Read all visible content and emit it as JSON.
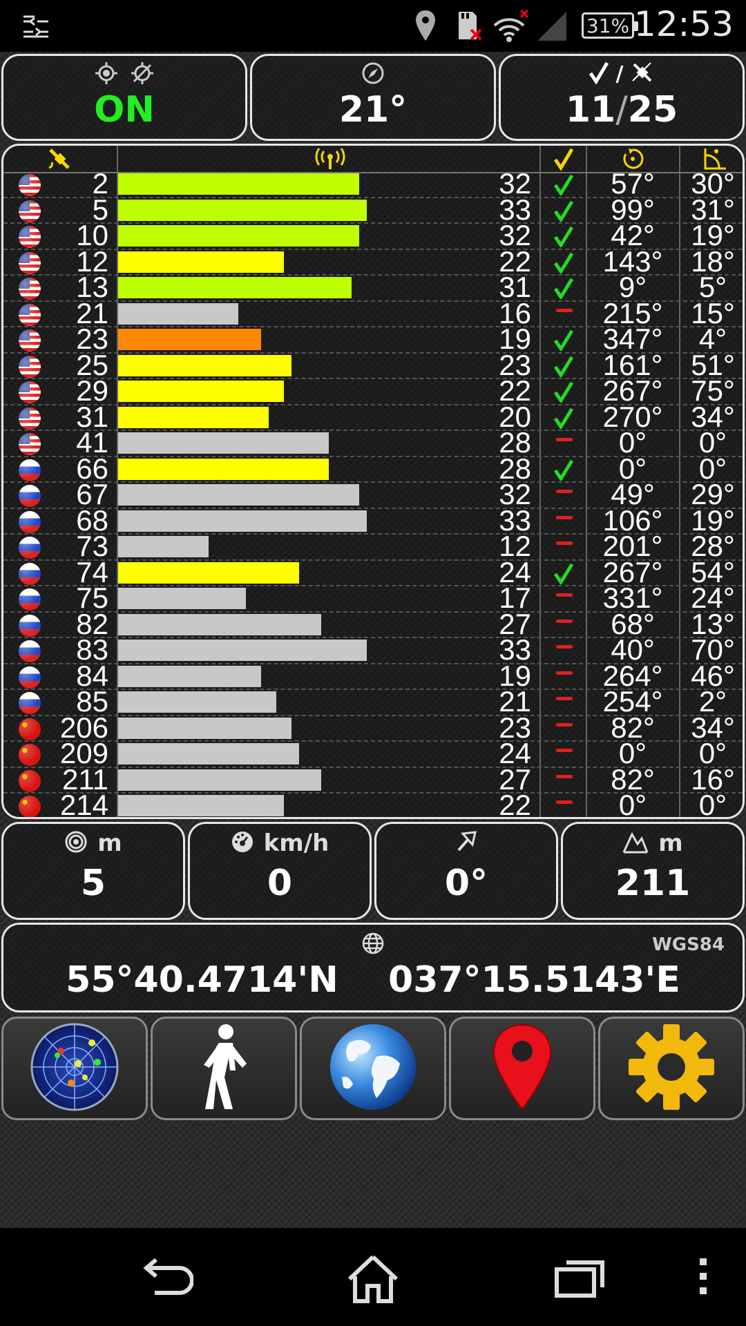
{
  "status_bar": {
    "time": "12:53",
    "battery": "31%",
    "icons": [
      "menu-sort-icon",
      "location-pin-icon",
      "sd-card-error-icon",
      "wifi-error-icon",
      "no-signal-icon",
      "battery-icon"
    ]
  },
  "tiles": {
    "gps_status": {
      "icons": [
        "gps-fix-icon",
        "gps-off-icon"
      ],
      "value": "ON",
      "color": "#22ee22"
    },
    "compass": {
      "icon": "compass-icon",
      "value": "21°"
    },
    "satellites": {
      "icons": [
        "check-icon",
        "satellite-icon"
      ],
      "separator": "/",
      "used": "11",
      "slash": "/",
      "total": "25"
    }
  },
  "table": {
    "header_icons": [
      "satellite-icon",
      "signal-icon",
      "check-icon",
      "azimuth-icon",
      "elevation-icon"
    ],
    "colors": {
      "good": "#bfff00",
      "mid": "#ffff00",
      "weak": "#ff8800",
      "unused": "#c8c8c8",
      "check": "#22dd22",
      "dash": "#e02020"
    },
    "rows": [
      {
        "flag": "us",
        "prn": "2",
        "snr": "32",
        "level": 32,
        "used": true,
        "az": "57°",
        "el": "30°",
        "color": "#bfff00"
      },
      {
        "flag": "us",
        "prn": "5",
        "snr": "33",
        "level": 33,
        "used": true,
        "az": "99°",
        "el": "31°",
        "color": "#bfff00"
      },
      {
        "flag": "us",
        "prn": "10",
        "snr": "32",
        "level": 32,
        "used": true,
        "az": "42°",
        "el": "19°",
        "color": "#bfff00"
      },
      {
        "flag": "us",
        "prn": "12",
        "snr": "22",
        "level": 22,
        "used": true,
        "az": "143°",
        "el": "18°",
        "color": "#ffff00"
      },
      {
        "flag": "us",
        "prn": "13",
        "snr": "31",
        "level": 31,
        "used": true,
        "az": "9°",
        "el": "5°",
        "color": "#bfff00"
      },
      {
        "flag": "us",
        "prn": "21",
        "snr": "16",
        "level": 16,
        "used": false,
        "az": "215°",
        "el": "15°",
        "color": "#c8c8c8"
      },
      {
        "flag": "us",
        "prn": "23",
        "snr": "19",
        "level": 19,
        "used": true,
        "az": "347°",
        "el": "4°",
        "color": "#ff8800"
      },
      {
        "flag": "us",
        "prn": "25",
        "snr": "23",
        "level": 23,
        "used": true,
        "az": "161°",
        "el": "51°",
        "color": "#ffff00"
      },
      {
        "flag": "us",
        "prn": "29",
        "snr": "22",
        "level": 22,
        "used": true,
        "az": "267°",
        "el": "75°",
        "color": "#ffff00"
      },
      {
        "flag": "us",
        "prn": "31",
        "snr": "20",
        "level": 20,
        "used": true,
        "az": "270°",
        "el": "34°",
        "color": "#ffff00"
      },
      {
        "flag": "us",
        "prn": "41",
        "snr": "28",
        "level": 28,
        "used": false,
        "az": "0°",
        "el": "0°",
        "color": "#c8c8c8"
      },
      {
        "flag": "ru",
        "prn": "66",
        "snr": "28",
        "level": 28,
        "used": true,
        "az": "0°",
        "el": "0°",
        "color": "#ffff00"
      },
      {
        "flag": "ru",
        "prn": "67",
        "snr": "32",
        "level": 32,
        "used": false,
        "az": "49°",
        "el": "29°",
        "color": "#c8c8c8"
      },
      {
        "flag": "ru",
        "prn": "68",
        "snr": "33",
        "level": 33,
        "used": false,
        "az": "106°",
        "el": "19°",
        "color": "#c8c8c8"
      },
      {
        "flag": "ru",
        "prn": "73",
        "snr": "12",
        "level": 12,
        "used": false,
        "az": "201°",
        "el": "28°",
        "color": "#c8c8c8"
      },
      {
        "flag": "ru",
        "prn": "74",
        "snr": "24",
        "level": 24,
        "used": true,
        "az": "267°",
        "el": "54°",
        "color": "#ffff00"
      },
      {
        "flag": "ru",
        "prn": "75",
        "snr": "17",
        "level": 17,
        "used": false,
        "az": "331°",
        "el": "24°",
        "color": "#c8c8c8"
      },
      {
        "flag": "ru",
        "prn": "82",
        "snr": "27",
        "level": 27,
        "used": false,
        "az": "68°",
        "el": "13°",
        "color": "#c8c8c8"
      },
      {
        "flag": "ru",
        "prn": "83",
        "snr": "33",
        "level": 33,
        "used": false,
        "az": "40°",
        "el": "70°",
        "color": "#c8c8c8"
      },
      {
        "flag": "ru",
        "prn": "84",
        "snr": "19",
        "level": 19,
        "used": false,
        "az": "264°",
        "el": "46°",
        "color": "#c8c8c8"
      },
      {
        "flag": "ru",
        "prn": "85",
        "snr": "21",
        "level": 21,
        "used": false,
        "az": "254°",
        "el": "2°",
        "color": "#c8c8c8"
      },
      {
        "flag": "cn",
        "prn": "206",
        "snr": "23",
        "level": 23,
        "used": false,
        "az": "82°",
        "el": "34°",
        "color": "#c8c8c8"
      },
      {
        "flag": "cn",
        "prn": "209",
        "snr": "24",
        "level": 24,
        "used": false,
        "az": "0°",
        "el": "0°",
        "color": "#c8c8c8"
      },
      {
        "flag": "cn",
        "prn": "211",
        "snr": "27",
        "level": 27,
        "used": false,
        "az": "82°",
        "el": "16°",
        "color": "#c8c8c8"
      },
      {
        "flag": "cn",
        "prn": "214",
        "snr": "22",
        "level": 22,
        "used": false,
        "az": "0°",
        "el": "0°",
        "color": "#c8c8c8"
      }
    ]
  },
  "metrics": {
    "accuracy": {
      "icon": "accuracy-icon",
      "unit": "m",
      "value": "5"
    },
    "speed": {
      "icon": "speedometer-icon",
      "unit": "km/h",
      "value": "0"
    },
    "bearing": {
      "icon": "bearing-icon",
      "value": "0°"
    },
    "altitude": {
      "icon": "altitude-icon",
      "unit": "m",
      "value": "211"
    }
  },
  "coordinates": {
    "icon": "globe-grid-icon",
    "datum": "WGS84",
    "lat": "55°40.4714'N",
    "lon": "037°15.5143'E"
  },
  "app_buttons": [
    "radar-button",
    "walk-button",
    "globe-button",
    "map-pin-button",
    "settings-button"
  ],
  "nav": [
    "back-button",
    "home-button",
    "recents-button",
    "overflow-menu-button"
  ]
}
